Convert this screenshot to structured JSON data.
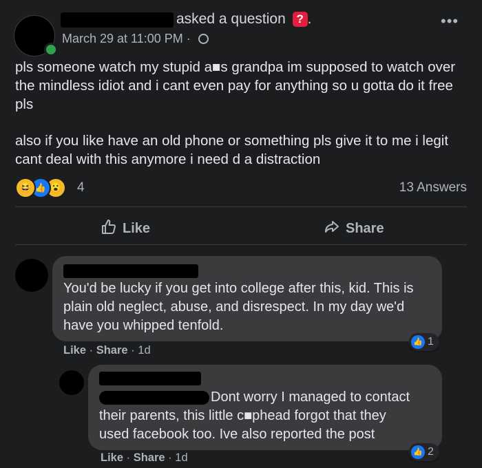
{
  "post": {
    "header_suffix": "asked a question",
    "question_badge": "?",
    "header_period": ".",
    "date": "March 29 at 11:00 PM",
    "date_sep": "·",
    "more": "•••",
    "paragraphs": [
      "pls someone watch my stupid a■s grandpa im supposed to watch over the mindless idiot and i cant even pay for anything so u gotta do it free pls",
      "also if you like have an old phone or something pls give it to me i legit cant deal with this anymore i need d a distraction"
    ],
    "reactions": [
      "haha-icon",
      "like-icon",
      "wow-icon"
    ],
    "reaction_count": "4",
    "answers": "13 Answers"
  },
  "actions": {
    "like": "Like",
    "share": "Share"
  },
  "comments": [
    {
      "text": "You'd be lucky if you get into college after this, kid. This is plain old neglect, abuse, and disrespect. In my day we'd have you whipped tenfold.",
      "like": "Like",
      "share": "Share",
      "sep": "·",
      "age": "1d",
      "reaction_count": "1"
    },
    {
      "text_lines": [
        "Dont worry I managed to contact",
        "their parents, this little c■phead forgot that they",
        "used facebook too. Ive also reported the post"
      ],
      "like": "Like",
      "share": "Share",
      "sep": "·",
      "age": "1d",
      "reaction_count": "2"
    }
  ],
  "colors": {
    "background": "#1c1d1f",
    "bubble": "#3a3b3c",
    "accent": "#1877f2",
    "question_badge": "#e41e3f"
  }
}
